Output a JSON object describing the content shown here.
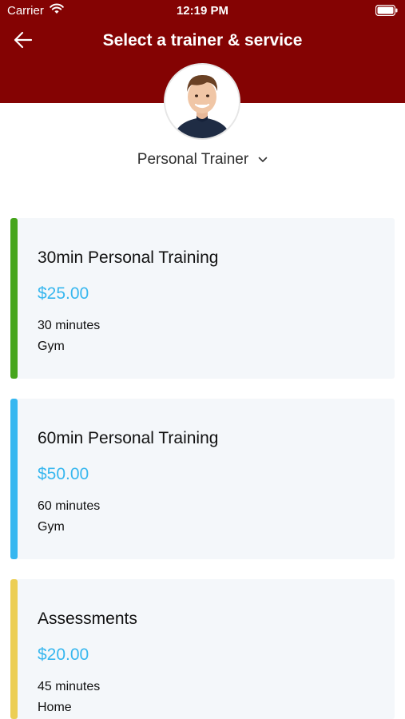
{
  "status_bar": {
    "carrier": "Carrier",
    "time": "12:19 PM"
  },
  "header": {
    "title": "Select a trainer & service",
    "back_icon": "arrow-left-icon",
    "background_color": "#840303"
  },
  "trainer": {
    "selected": "Personal Trainer",
    "dropdown_icon": "chevron-down-icon"
  },
  "services": [
    {
      "title": "30min Personal Training",
      "price": "$25.00",
      "duration": "30 minutes",
      "location": "Gym",
      "accent_color": "#46a51c"
    },
    {
      "title": "60min Personal Training",
      "price": "$50.00",
      "duration": "60 minutes",
      "location": "Gym",
      "accent_color": "#36b7f0"
    },
    {
      "title": "Assessments",
      "price": "$20.00",
      "duration": "45 minutes",
      "location": "Home",
      "accent_color": "#ecce53"
    }
  ],
  "colors": {
    "price": "#37b7ef",
    "card_background": "#f4f7fa"
  }
}
